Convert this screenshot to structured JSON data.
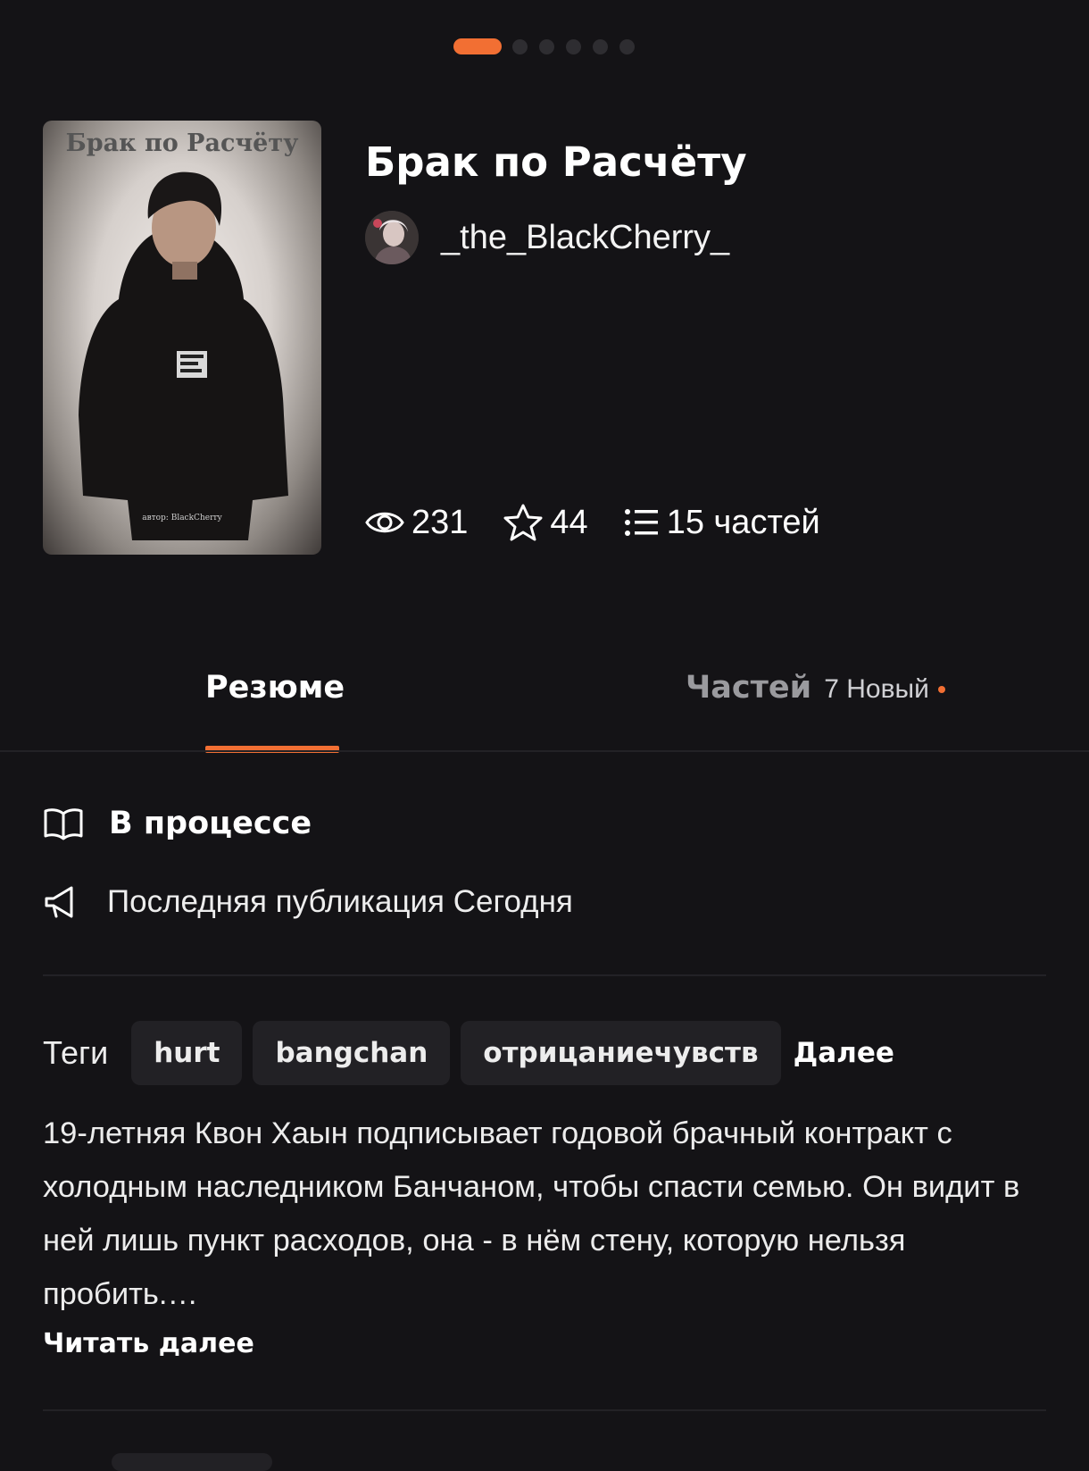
{
  "pager": {
    "count": 6,
    "active_index": 0,
    "active_color": "#f26f33"
  },
  "book": {
    "cover_title": "Брак по Расчёту",
    "cover_author": "автор: BlackCherry",
    "title": "Брак по Расчёту",
    "author": "_the_BlackCherry_"
  },
  "stats": {
    "views": "231",
    "stars": "44",
    "parts": "15 частей"
  },
  "tabs": {
    "summary": "Резюме",
    "parts": "Частей",
    "parts_badge": "7 Новый",
    "accent": "#f26f33"
  },
  "info": {
    "status": "В процессе",
    "last_publication": "Последняя публикация Сегодня"
  },
  "tags": {
    "label": "Теги",
    "items": [
      "hurt",
      "bangchan",
      "отрицаниечувств"
    ],
    "more": "Далее"
  },
  "description": {
    "text": "19-летняя Квон Хаын подписывает годовой брачный контракт с холодным наследником Банчаном, чтобы спасти семью. Он видит в ней лишь пункт расходов, она - в нём стену, которую нельзя пробить.…",
    "read_more": "Читать далее"
  },
  "icons": {
    "views": "eye-icon",
    "stars": "star-icon",
    "parts": "list-icon",
    "status": "book-icon",
    "last_publication": "megaphone-icon"
  }
}
